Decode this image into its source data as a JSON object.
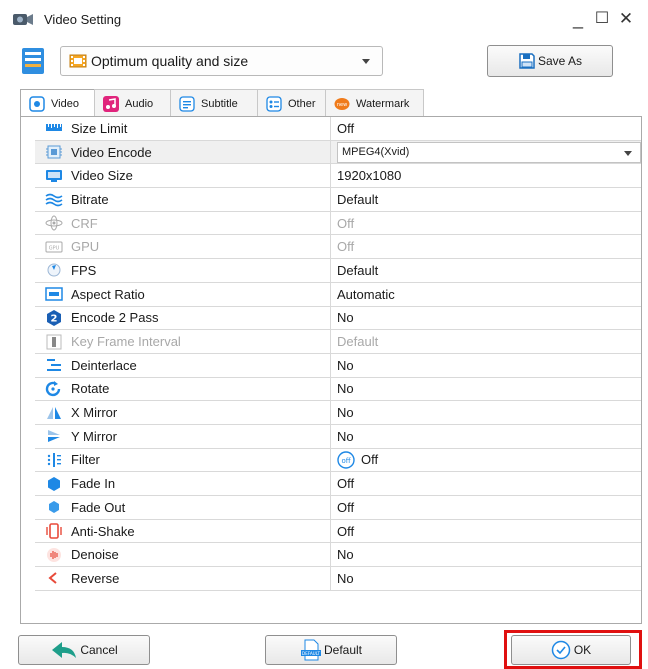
{
  "window": {
    "title": "Video Setting",
    "minimize_glyph": "_",
    "maximize_glyph": "☐",
    "close_glyph": "✕"
  },
  "toolbar": {
    "profile_label": "Optimum quality and size",
    "save_as_label": "Save As"
  },
  "tabs": [
    {
      "label": "Video",
      "icon": "video-icon",
      "active": true
    },
    {
      "label": "Audio",
      "icon": "music-note-icon",
      "active": false
    },
    {
      "label": "Subtitle",
      "icon": "subtitle-icon",
      "active": false
    },
    {
      "label": "Other",
      "icon": "settings-list-icon",
      "active": false
    },
    {
      "label": "Watermark",
      "icon": "watermark-icon",
      "active": false
    }
  ],
  "settings": [
    {
      "name": "Size Limit",
      "value": "Off",
      "icon": "ruler-icon",
      "disabled": false
    },
    {
      "name": "Video Encode",
      "value": "MPEG4(Xvid)",
      "icon": "chip-icon",
      "disabled": false,
      "dropdown": true,
      "selected": true
    },
    {
      "name": "Video Size",
      "value": "1920x1080",
      "icon": "monitor-icon",
      "disabled": false
    },
    {
      "name": "Bitrate",
      "value": "Default",
      "icon": "wave-icon",
      "disabled": false
    },
    {
      "name": "CRF",
      "value": "Off",
      "icon": "atom-icon",
      "disabled": true
    },
    {
      "name": "GPU",
      "value": "Off",
      "icon": "gpu-icon",
      "disabled": true
    },
    {
      "name": "FPS",
      "value": "Default",
      "icon": "fps-icon",
      "disabled": false
    },
    {
      "name": "Aspect Ratio",
      "value": "Automatic",
      "icon": "aspect-ratio-icon",
      "disabled": false
    },
    {
      "name": "Encode 2 Pass",
      "value": "No",
      "icon": "two-pass-icon",
      "disabled": false
    },
    {
      "name": "Key Frame Interval",
      "value": "Default",
      "icon": "keyframe-icon",
      "disabled": true
    },
    {
      "name": "Deinterlace",
      "value": "No",
      "icon": "deinterlace-icon",
      "disabled": false
    },
    {
      "name": "Rotate",
      "value": "No",
      "icon": "rotate-icon",
      "disabled": false
    },
    {
      "name": "X Mirror",
      "value": "No",
      "icon": "x-mirror-icon",
      "disabled": false
    },
    {
      "name": "Y Mirror",
      "value": "No",
      "icon": "y-mirror-icon",
      "disabled": false
    },
    {
      "name": "Filter",
      "value": "Off",
      "icon": "filter-icon",
      "disabled": false,
      "toggle_icon": "off-toggle-icon"
    },
    {
      "name": "Fade In",
      "value": "Off",
      "icon": "fade-in-icon",
      "disabled": false
    },
    {
      "name": "Fade Out",
      "value": "Off",
      "icon": "fade-out-icon",
      "disabled": false
    },
    {
      "name": "Anti-Shake",
      "value": "Off",
      "icon": "anti-shake-icon",
      "disabled": false
    },
    {
      "name": "Denoise",
      "value": "No",
      "icon": "denoise-icon",
      "disabled": false
    },
    {
      "name": "Reverse",
      "value": "No",
      "icon": "reverse-icon",
      "disabled": false
    }
  ],
  "footer": {
    "cancel_label": "Cancel",
    "default_label": "Default",
    "ok_label": "OK"
  },
  "colors": {
    "accent_blue": "#1e88e5",
    "highlight_red": "#e01010",
    "disabled_text": "#a8a8a8"
  }
}
